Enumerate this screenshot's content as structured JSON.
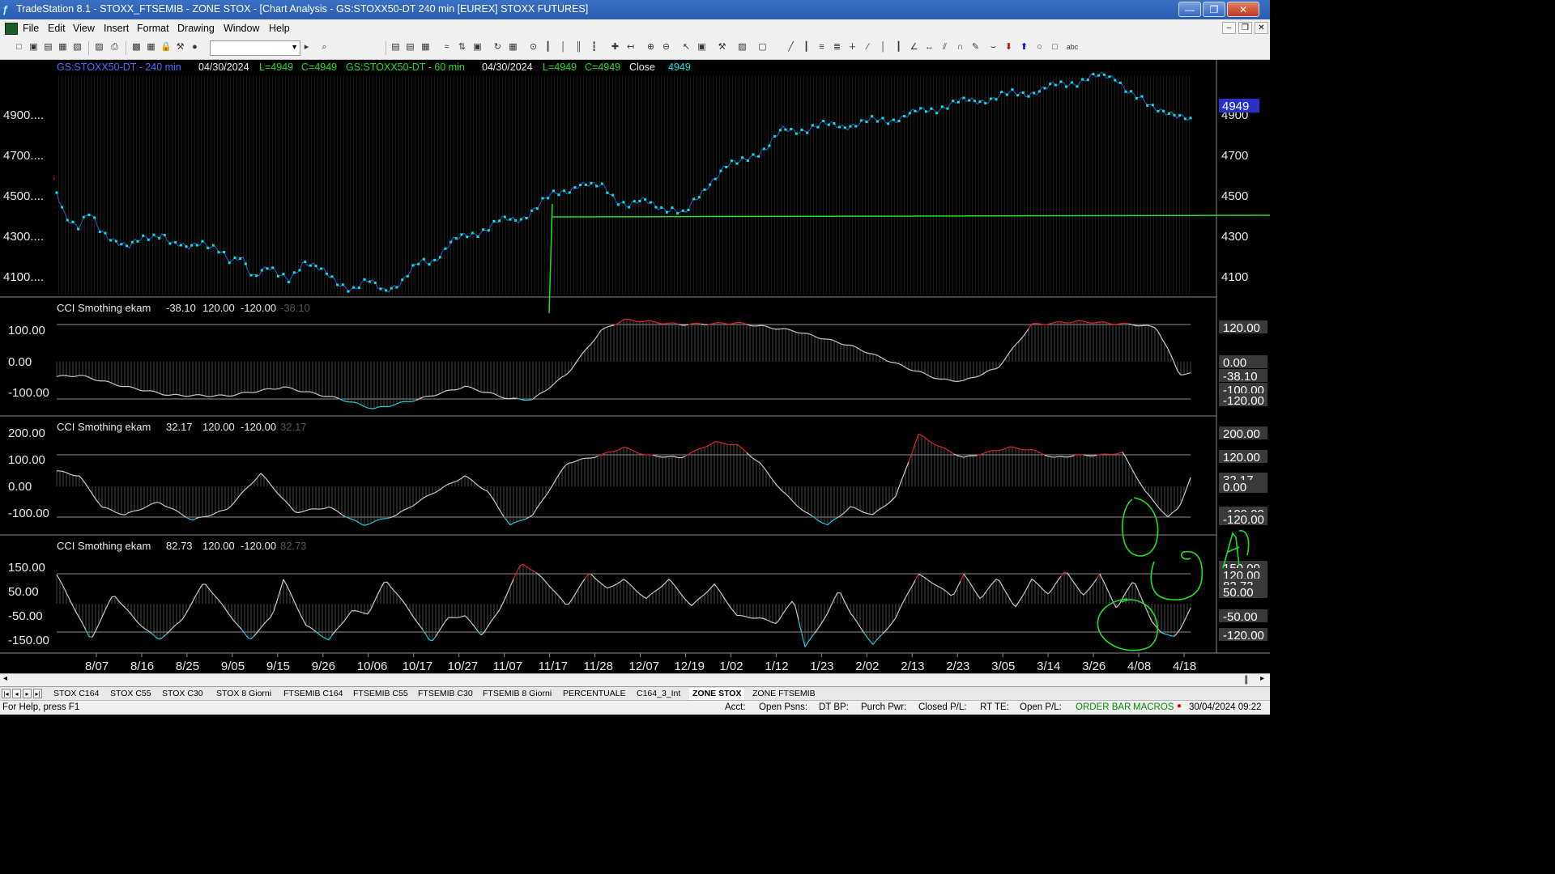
{
  "window": {
    "title": "TradeStation 8.1 - STOXX_FTSEMIB - ZONE STOX - [Chart Analysis - GS:STOXX50-DT  240 min  [EUREX] STOXX FUTURES]",
    "controls": {
      "minimize": "—",
      "restore": "❐",
      "close": "✕"
    }
  },
  "menu": [
    "File",
    "Edit",
    "View",
    "Insert",
    "Format",
    "Drawing",
    "Window",
    "Help"
  ],
  "mdi_controls": {
    "minimize": "–",
    "restore": "❐",
    "close": "✕"
  },
  "toolbar": {
    "combo_value": ""
  },
  "chart": {
    "header": {
      "sym1": "GS:STOXX50-DT - 240 min",
      "date1": "04/30/2024",
      "l1": "L=4949",
      "c1": "C=4949",
      "sym2": "GS:STOXX50-DT - 60 min",
      "date2": "04/30/2024",
      "l2": "L=4949",
      "c2": "C=4949",
      "close_label": "Close",
      "close_val": "4949"
    },
    "price_axis_left": [
      "4900....",
      "4700....",
      "4500....",
      "4300....",
      "4100...."
    ],
    "price_axis_right": [
      "4900",
      "4700",
      "4500",
      "4300",
      "4100"
    ],
    "last_price_tag": "4949",
    "indicators": [
      {
        "name": "CCI Smothing ekam",
        "value": "-38.10",
        "upper": "120.00",
        "lower": "-120.00",
        "ghost": "-38.10",
        "left_ticks": [
          "100.00",
          "0.00",
          "-100.00"
        ],
        "right_tags": [
          "120.00",
          "0.00",
          "-38.10",
          "-100.00",
          "-120.00"
        ]
      },
      {
        "name": "CCI Smothing ekam",
        "value": "32.17",
        "upper": "120.00",
        "lower": "-120.00",
        "ghost": "32.17",
        "left_ticks": [
          "200.00",
          "100.00",
          "0.00",
          "-100.00"
        ],
        "right_tags": [
          "200.00",
          "120.00",
          "32.17",
          "0.00",
          "-100.00",
          "-120.00"
        ]
      },
      {
        "name": "CCI Smothing ekam",
        "value": "82.73",
        "upper": "120.00",
        "lower": "-120.00",
        "ghost": "82.73",
        "left_ticks": [
          "150.00",
          "50.00",
          "-50.00",
          "-150.00"
        ],
        "right_tags": [
          "150.00",
          "120.00",
          "82.73",
          "50.00",
          "-50.00",
          "-120.00"
        ]
      }
    ],
    "date_axis": [
      "8/07",
      "8/16",
      "8/25",
      "9/05",
      "9/15",
      "9/26",
      "10/06",
      "10/17",
      "10/27",
      "11/07",
      "11/17",
      "11/28",
      "12/07",
      "12/19",
      "1/02",
      "1/12",
      "1/23",
      "2/02",
      "2/13",
      "2/23",
      "3/05",
      "3/14",
      "3/26",
      "4/08",
      "4/18"
    ],
    "colors": {
      "price_line": "#00e5ee",
      "support_line": "#22dd22",
      "cci_line": "#c8c8c8",
      "cci_overbought": "#dd2222",
      "cci_oversold": "#22c8dd",
      "header_sym": "#4a6cff",
      "header_green": "#22dd22"
    }
  },
  "tabs": [
    "STOX C164",
    "STOX C55",
    "STOX  C30",
    "STOX  8 Giorni",
    "FTSEMIB C164",
    "FTSEMIB C55",
    "FTSEMIB C30",
    "FTSEMIB  8 Giorni",
    "PERCENTUALE",
    "C164_3_Int",
    "ZONE STOX",
    "ZONE FTSEMIB"
  ],
  "active_tab": "ZONE STOX",
  "status": {
    "help": "For Help, press F1",
    "acct": "Acct:",
    "open_psns": "Open Psns:",
    "dt_bp": "DT BP:",
    "purch_pwr": "Purch Pwr:",
    "closed_pl": "Closed P/L:",
    "rt_te": "RT TE:",
    "open_pl": "Open P/L:",
    "order_bar": "ORDER BAR",
    "macros": "MACROS",
    "datetime": "30/04/2024 09:22"
  }
}
